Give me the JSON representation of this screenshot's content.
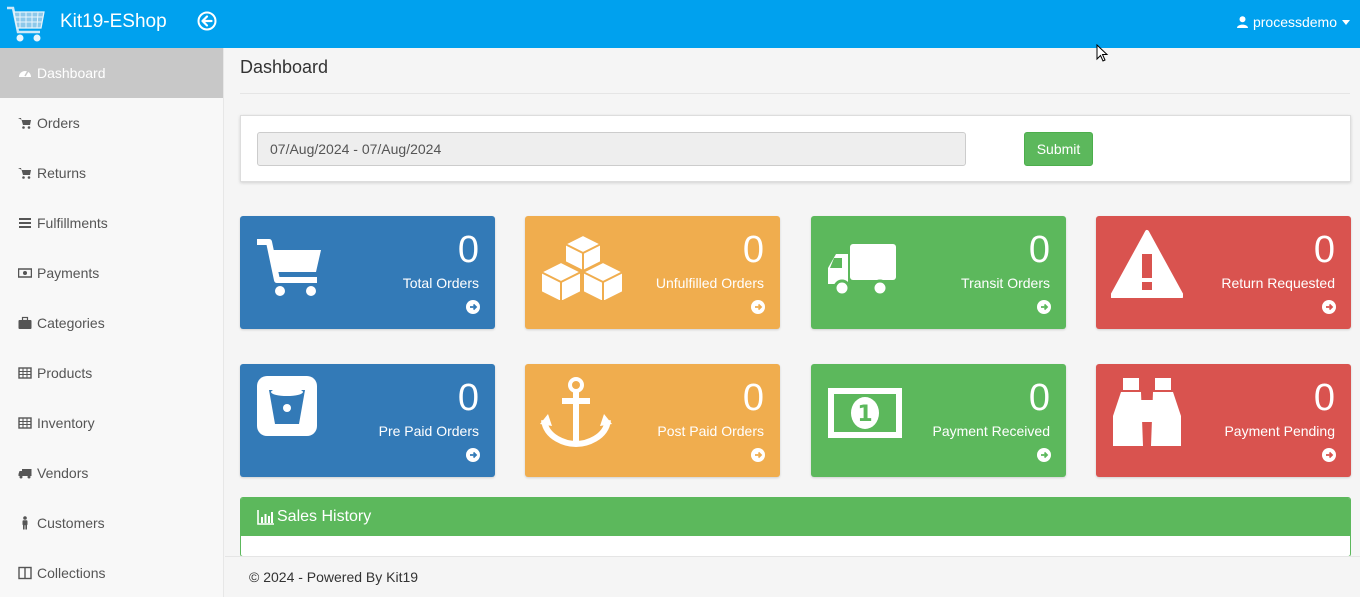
{
  "header": {
    "brand": "Kit19-EShop",
    "user": "processdemo"
  },
  "sidebar": {
    "items": [
      {
        "label": "Dashboard",
        "icon": "dashboard-icon",
        "active": true
      },
      {
        "label": "Orders",
        "icon": "cart-icon"
      },
      {
        "label": "Returns",
        "icon": "cart-icon"
      },
      {
        "label": "Fulfillments",
        "icon": "list-icon"
      },
      {
        "label": "Payments",
        "icon": "money-icon"
      },
      {
        "label": "Categories",
        "icon": "briefcase-icon"
      },
      {
        "label": "Products",
        "icon": "table-icon"
      },
      {
        "label": "Inventory",
        "icon": "table-icon"
      },
      {
        "label": "Vendors",
        "icon": "truck-icon"
      },
      {
        "label": "Customers",
        "icon": "male-icon"
      },
      {
        "label": "Collections",
        "icon": "columns-icon"
      }
    ]
  },
  "main": {
    "title": "Dashboard",
    "date_range": "07/Aug/2024 - 07/Aug/2024",
    "submit_label": "Submit"
  },
  "tiles": [
    {
      "count": "0",
      "label": "Total Orders",
      "icon": "cart-icon",
      "color": "#337ab7"
    },
    {
      "count": "0",
      "label": "Unfulfilled Orders",
      "icon": "cubes-icon",
      "color": "#f0ad4e"
    },
    {
      "count": "0",
      "label": "Transit Orders",
      "icon": "truck-icon",
      "color": "#5cb85c"
    },
    {
      "count": "0",
      "label": "Return Requested",
      "icon": "warning-icon",
      "color": "#d9534f"
    },
    {
      "count": "0",
      "label": "Pre Paid Orders",
      "icon": "bitbucket-icon",
      "color": "#337ab7"
    },
    {
      "count": "0",
      "label": "Post Paid Orders",
      "icon": "anchor-icon",
      "color": "#f0ad4e"
    },
    {
      "count": "0",
      "label": "Payment Received",
      "icon": "money-icon",
      "color": "#5cb85c"
    },
    {
      "count": "0",
      "label": "Payment Pending",
      "icon": "binoculars-icon",
      "color": "#d9534f"
    }
  ],
  "sales_history": {
    "title": "Sales History"
  },
  "footer": {
    "text": "© 2024 - Powered By Kit19"
  }
}
